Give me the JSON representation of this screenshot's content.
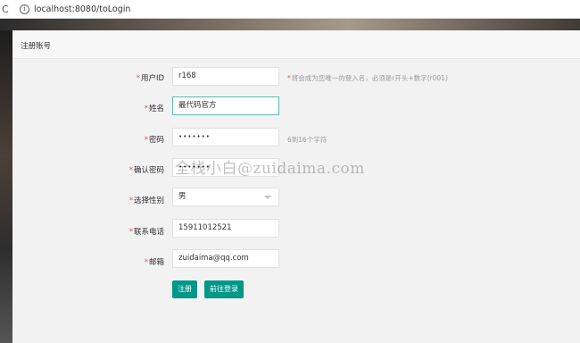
{
  "browser": {
    "url": "localhost:8080/toLogin"
  },
  "header": {
    "title": "注册账号"
  },
  "form": {
    "required_mark": "*",
    "userid": {
      "label": "用户ID",
      "value": "r168",
      "hint": "将会成为您唯一的登入名，必须是r开头+数字(r001)"
    },
    "name": {
      "label": "姓名",
      "value": "最代码官方"
    },
    "password": {
      "label": "密码",
      "value": "•••••••",
      "hint": "6到16个字符"
    },
    "confirm": {
      "label": "确认密码",
      "value": "•••••••"
    },
    "gender": {
      "label": "选择性别",
      "value": "男"
    },
    "phone": {
      "label": "联系电话",
      "value": "15911012521"
    },
    "email": {
      "label": "邮箱",
      "value": "zuidaima@qq.com"
    }
  },
  "buttons": {
    "register": "注册",
    "goto_login": "前往登录"
  },
  "watermark": "全栈小白@zuidaima.com"
}
